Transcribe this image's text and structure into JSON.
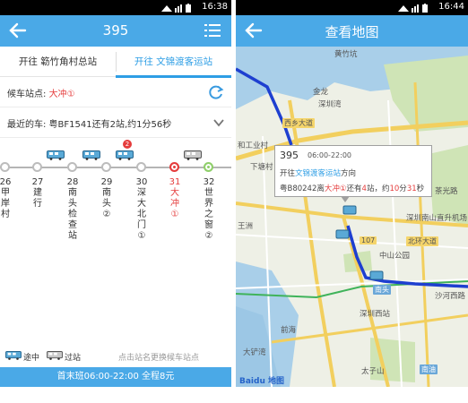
{
  "left": {
    "status_time": "16:38",
    "title": "395",
    "tabs": [
      {
        "label": "开往 簕竹角村总站",
        "active": false
      },
      {
        "label": "开往 文锦渡客运站",
        "active": true
      }
    ],
    "wait_stop": {
      "label": "候车站点: ",
      "value": "大冲",
      "marker": "①"
    },
    "recent_bus": "最近的车: 粤BF1541还有2站,约1分56秒",
    "stops": [
      {
        "name": "26甲岸村",
        "state": "passed"
      },
      {
        "name": "27建行",
        "state": "passed"
      },
      {
        "name": "28南头检查站",
        "state": "passed"
      },
      {
        "name": "29南头②",
        "state": "passed"
      },
      {
        "name": "30深大北门①",
        "state": "passed"
      },
      {
        "name": "31大冲①",
        "state": "current"
      },
      {
        "name": "32世界之窗②",
        "state": "next"
      }
    ],
    "badge_count": "2",
    "legend": {
      "enroute": "途中",
      "arrived": "过站",
      "hint": "点击站名更换候车站点"
    },
    "footer": "首末班06:00-22:00 全程8元"
  },
  "right": {
    "status_time": "16:44",
    "title": "查看地图",
    "popup": {
      "line": "395",
      "time": "06:00-22:00",
      "dir_prefix": "开往",
      "dir_target": "文锦渡客运站",
      "dir_suffix": "方向",
      "status_prefix": "粤B80242离",
      "status_stop": "大冲",
      "status_marker": "①",
      "status_mid": "还有",
      "status_count": "4",
      "status_mid2": "站，约",
      "status_min": "10",
      "status_mid3": "分",
      "status_sec": "31",
      "status_suffix": "秒"
    },
    "map_labels": {
      "l1": "黄竹坑",
      "l2": "金龙",
      "l3": "西乡大道",
      "l4": "和工业村",
      "l5": "下塘村",
      "l6": "王洲",
      "l7": "深圳南山直升机场",
      "l8": "北环大道",
      "l9": "中山公园",
      "l10": "南头",
      "l11": "深圳西站",
      "l12": "前海",
      "l13": "大铲湾",
      "l14": "太子山",
      "l15": "南油",
      "l16": "茶光路",
      "l17": "107",
      "l18": "沙河西路",
      "l19": "深圳湾"
    },
    "map_logo": "Baidu 地图"
  },
  "colors": {
    "accent": "#4aa9e7",
    "highlight": "#2e9ee5",
    "alert": "#e53c3c"
  }
}
